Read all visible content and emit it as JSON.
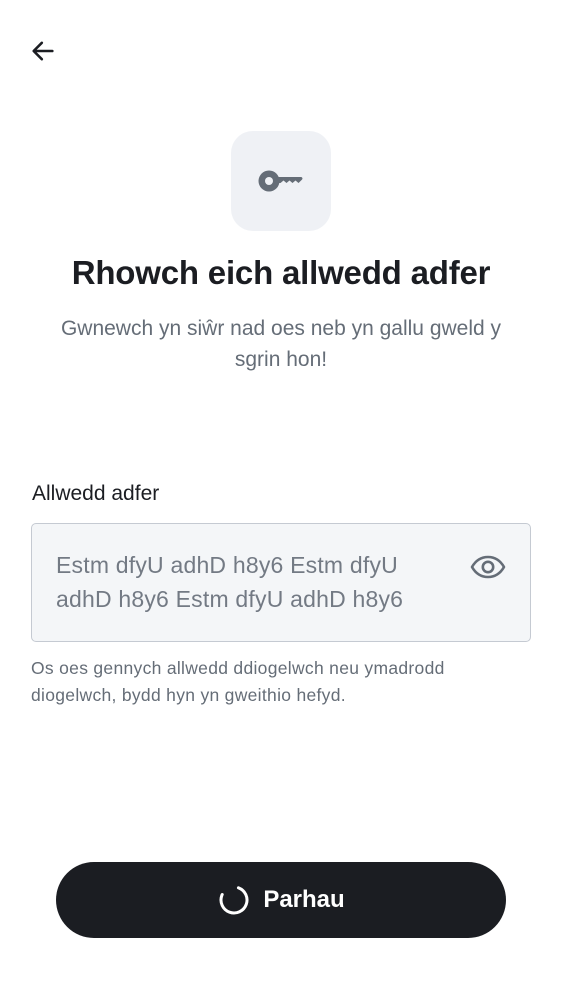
{
  "header": {
    "back_icon": "arrow-left-icon"
  },
  "hero": {
    "icon": "key-icon",
    "title": "Rhowch eich allwedd adfer",
    "subtitle": "Gwnewch yn siŵr nad oes neb yn gallu gweld y sgrin hon!"
  },
  "form": {
    "label": "Allwedd adfer",
    "value": "Estm dfyU adhD h8y6 Estm dfyU adhD h8y6 Estm dfyU adhD h8y6",
    "visibility_icon": "eye-icon",
    "help_text": "Os oes gennych allwedd ddiogelwch neu ymadrodd diogelwch, bydd hyn yn gweithio hefyd."
  },
  "actions": {
    "continue_label": "Parhau",
    "loading_icon": "spinner-icon"
  },
  "colors": {
    "background": "#ffffff",
    "primary": "#1b1d22",
    "muted_text": "#656d77",
    "tile": "#eff1f5",
    "field_bg": "#f4f6f8",
    "field_border": "#c5cad2"
  }
}
